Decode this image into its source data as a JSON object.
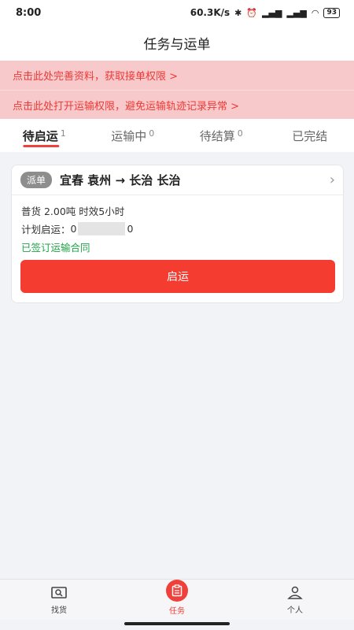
{
  "status_bar": {
    "time": "8:00",
    "network_speed": "60.3K/s",
    "battery": "93"
  },
  "header": {
    "title": "任务与运单"
  },
  "notices": [
    {
      "text": "点击此处完善资料，获取接单权限 >"
    },
    {
      "text": "点击此处打开运输权限，避免运输轨迹记录异常 >"
    }
  ],
  "tabs": [
    {
      "label": "待启运",
      "count": "1",
      "active": true
    },
    {
      "label": "运输中",
      "count": "0",
      "active": false
    },
    {
      "label": "待结算",
      "count": "0",
      "active": false
    },
    {
      "label": "已完结",
      "count": "",
      "active": false
    }
  ],
  "order_card": {
    "tag": "派单",
    "route": "宜春 袁州 → 长治 长治",
    "cargo_info": "普货  2.00吨  时效5小时",
    "plan_label": "计划启运：",
    "plan_prefix": "0",
    "plan_suffix": "0",
    "contract_status": "已签订运输合同",
    "start_button": "启运"
  },
  "bottom_nav": [
    {
      "label": "找货",
      "icon": "find-cargo-icon",
      "active": false
    },
    {
      "label": "任务",
      "icon": "task-icon",
      "active": true
    },
    {
      "label": "个人",
      "icon": "person-icon",
      "active": false
    }
  ],
  "colors": {
    "accent": "#f0403b",
    "notice_bg": "#f7c9cb",
    "notice_text": "#ee3a36",
    "contract_green": "#1fa347"
  }
}
